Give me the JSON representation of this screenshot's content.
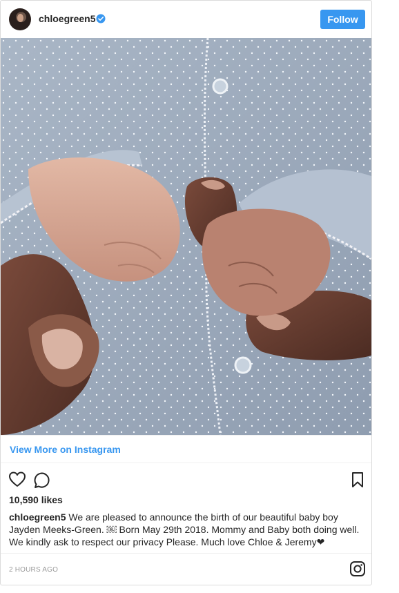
{
  "post": {
    "username": "chloegreen5",
    "follow_label": "Follow",
    "view_more_label": "View More on Instagram",
    "likes": "10,590 likes",
    "caption_user": "chloegreen5",
    "caption_text": "We are pleased to announce the birth of our beautiful baby boy Jayden Meeks-Green. ￼ Born May 29th 2018. Mommy and Baby both doing well. We kindly ask to respect our privacy Please. Much love Chloe & Jeremy❤",
    "timestamp": "2 HOURS AGO"
  },
  "icons": {
    "verified": "verified-badge-icon",
    "like": "heart-icon",
    "comment": "comment-icon",
    "save": "bookmark-icon",
    "brand": "instagram-icon"
  },
  "colors": {
    "accent": "#3897f0",
    "text": "#262626",
    "muted": "#999999",
    "border": "#dbdbdb"
  }
}
